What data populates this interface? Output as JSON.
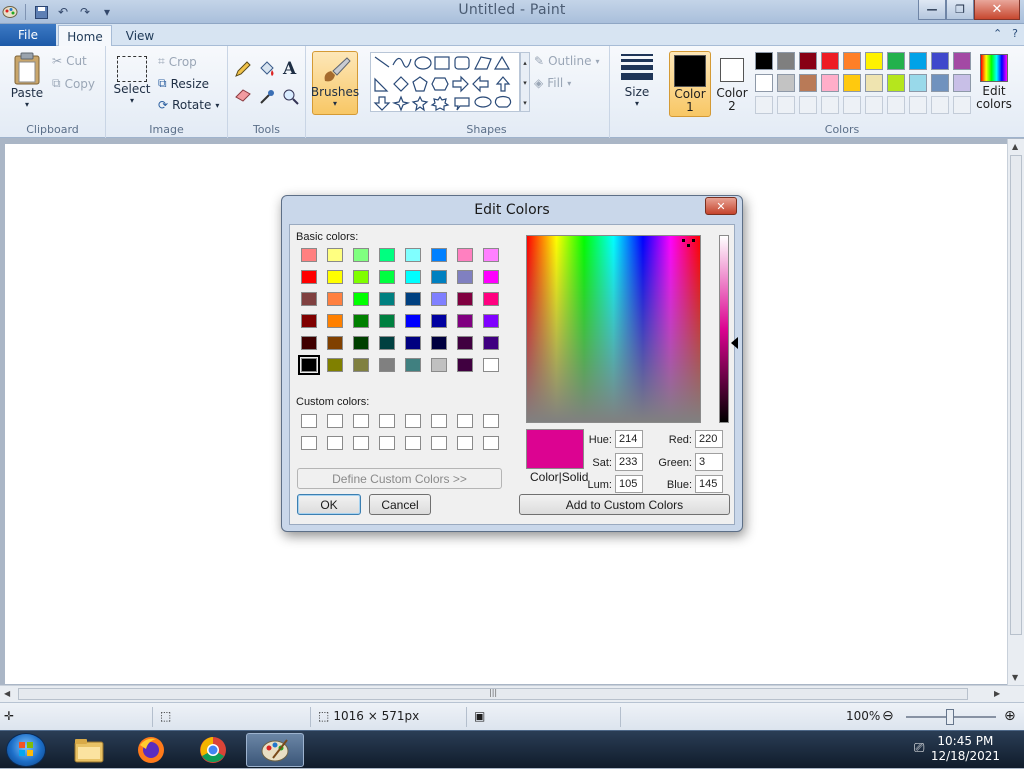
{
  "window": {
    "title": "Untitled - Paint",
    "controls": {
      "minimize": "—",
      "restore": "❐",
      "close": "✕"
    }
  },
  "tabs": {
    "file": "File",
    "home": "Home",
    "view": "View"
  },
  "ribbon": {
    "clipboard": {
      "label": "Clipboard",
      "paste": "Paste",
      "cut": "Cut",
      "copy": "Copy"
    },
    "image": {
      "label": "Image",
      "select": "Select",
      "crop": "Crop",
      "resize": "Resize",
      "rotate": "Rotate"
    },
    "tools": {
      "label": "Tools"
    },
    "brushes": {
      "label": "Brushes"
    },
    "shapes": {
      "label": "Shapes",
      "outline": "Outline",
      "fill": "Fill"
    },
    "size": {
      "label": "Size"
    },
    "color1": {
      "line1": "Color",
      "line2": "1",
      "color": "#000000"
    },
    "color2": {
      "line1": "Color",
      "line2": "2",
      "color": "#ffffff"
    },
    "colors": {
      "label": "Colors",
      "edit_line1": "Edit",
      "edit_line2": "colors",
      "row1": [
        "#000000",
        "#7f7f7f",
        "#880015",
        "#ed1c24",
        "#ff7f27",
        "#fff200",
        "#22b14c",
        "#00a2e8",
        "#3f48cc",
        "#a349a4"
      ],
      "row2": [
        "#ffffff",
        "#c3c3c3",
        "#b97a57",
        "#ffaec9",
        "#ffc90e",
        "#efe4b0",
        "#b5e61d",
        "#99d9ea",
        "#7092be",
        "#c8bfe7"
      ]
    }
  },
  "dialog": {
    "title": "Edit Colors",
    "basic_colors_label": "Basic colors:",
    "custom_colors_label": "Custom colors:",
    "define_custom": "Define Custom Colors >>",
    "ok": "OK",
    "cancel": "Cancel",
    "add_custom": "Add to Custom Colors",
    "color_solid_label": "Color|Solid",
    "current_color": "#dc0391",
    "hue_label": "Hue:",
    "hue": "214",
    "sat_label": "Sat:",
    "sat": "233",
    "lum_label": "Lum:",
    "lum": "105",
    "red_label": "Red:",
    "red": "220",
    "green_label": "Green:",
    "green": "3",
    "blue_label": "Blue:",
    "blue": "145",
    "basic_colors": [
      [
        "#ff8080",
        "#ffff80",
        "#80ff80",
        "#00ff80",
        "#80ffff",
        "#0080ff",
        "#ff80c0",
        "#ff80ff"
      ],
      [
        "#ff0000",
        "#ffff00",
        "#80ff00",
        "#00ff40",
        "#00ffff",
        "#0080c0",
        "#8080c0",
        "#ff00ff"
      ],
      [
        "#804040",
        "#ff8040",
        "#00ff00",
        "#008080",
        "#004080",
        "#8080ff",
        "#800040",
        "#ff0080"
      ],
      [
        "#800000",
        "#ff8000",
        "#008000",
        "#008040",
        "#0000ff",
        "#0000a0",
        "#800080",
        "#8000ff"
      ],
      [
        "#400000",
        "#804000",
        "#004000",
        "#004040",
        "#000080",
        "#000040",
        "#400040",
        "#400080"
      ],
      [
        "#000000",
        "#808000",
        "#808040",
        "#808080",
        "#408080",
        "#c0c0c0",
        "#400040",
        "#ffffff"
      ]
    ]
  },
  "statusbar": {
    "dimensions": "1016 × 571px",
    "zoom": "100%"
  },
  "taskbar": {
    "time": "10:45 PM",
    "date": "12/18/2021"
  }
}
